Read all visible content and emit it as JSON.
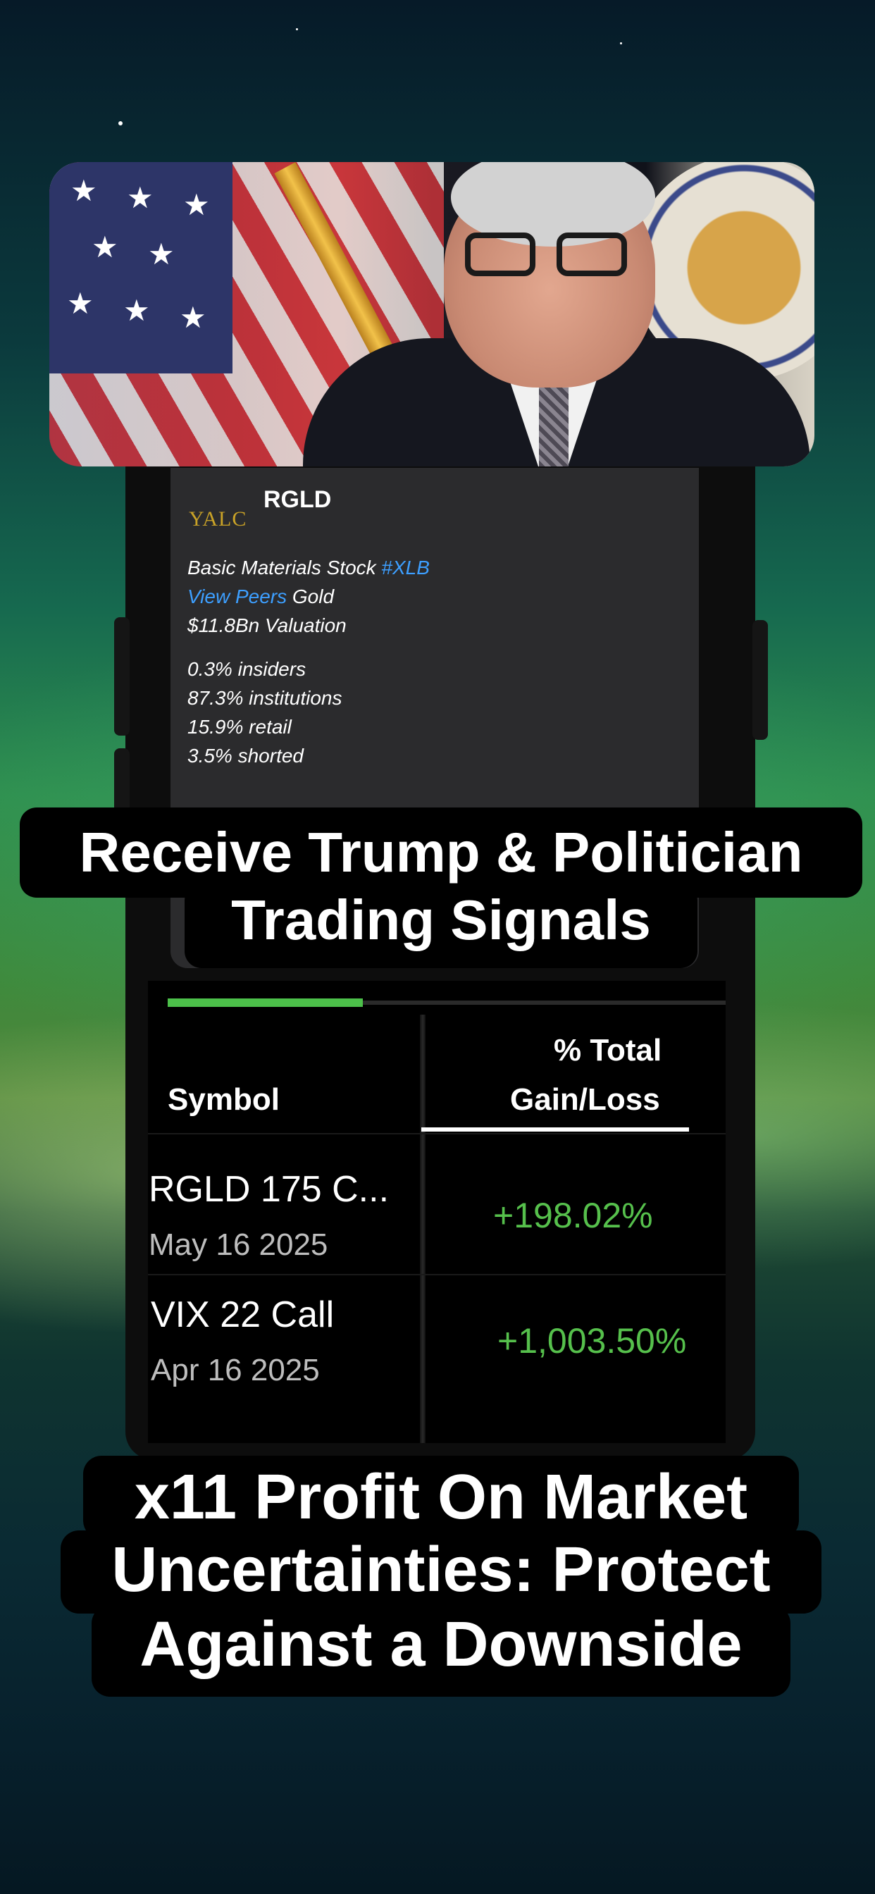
{
  "colors": {
    "gain_green": "#56c04c",
    "link_blue": "#3d9fff",
    "progress_green": "#4cc04a",
    "logo_gold": "#c9a227"
  },
  "stock_card": {
    "logo_text": "YALC",
    "ticker": "RGLD",
    "sector_prefix": "Basic Materials Stock",
    "sector_tag": "#XLB",
    "view_peers": "View Peers",
    "industry": "Gold",
    "valuation": "$11.8Bn Valuation",
    "insiders": "0.3% insiders",
    "institutions": "87.3% institutions",
    "retail": "15.9% retail",
    "shorted": "3.5% shorted"
  },
  "captions": {
    "top_line1": "Receive Trump & Politician",
    "top_line2": "Trading Signals",
    "bottom_line1": "x11 Profit On Market",
    "bottom_line2": "Uncertainties: Protect",
    "bottom_line3": "Against a Downside"
  },
  "positions": {
    "progress_fraction": 0.35,
    "header_symbol": "Symbol",
    "header_gain_line1": "% Total",
    "header_gain_line2": "Gain/Loss",
    "rows": [
      {
        "symbol": "RGLD 175 C...",
        "date": "May 16 2025",
        "gain": "+198.02%"
      },
      {
        "symbol": "VIX 22 Call",
        "date": "Apr 16 2025",
        "gain": "+1,003.50%"
      }
    ]
  }
}
